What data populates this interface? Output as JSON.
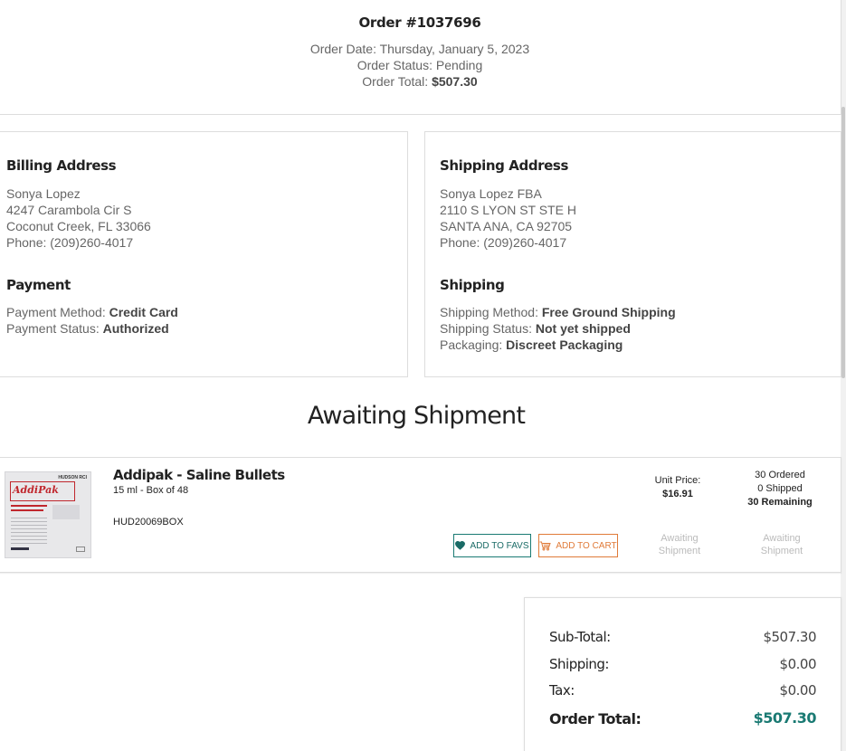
{
  "order": {
    "number": "Order #1037696",
    "date_label": "Order Date:",
    "date_value": "Thursday, January 5, 2023",
    "status_label": "Order Status:",
    "status_value": "Pending",
    "total_label": "Order Total:",
    "total_value": "$507.30"
  },
  "billing": {
    "title": "Billing Address",
    "name": "Sonya Lopez",
    "street": "4247 Carambola Cir S",
    "city": "Coconut Creek, FL 33066",
    "phone": "Phone: (209)260-4017"
  },
  "payment": {
    "title": "Payment",
    "method_label": "Payment Method:",
    "method_value": "Credit Card",
    "status_label": "Payment Status:",
    "status_value": "Authorized"
  },
  "shipping_address": {
    "title": "Shipping Address",
    "name": "Sonya Lopez FBA",
    "street": "2110 S LYON ST STE H",
    "city": "SANTA ANA, CA 92705",
    "phone": "Phone: (209)260-4017"
  },
  "shipping": {
    "title": "Shipping",
    "method_label": "Shipping Method:",
    "method_value": "Free Ground Shipping",
    "status_label": "Shipping Status:",
    "status_value": "Not yet shipped",
    "packaging_label": "Packaging:",
    "packaging_value": "Discreet Packaging"
  },
  "section_title": "Awaiting Shipment",
  "item": {
    "name": "Addipak - Saline Bullets",
    "size": "15 ml - Box of 48",
    "sku": "HUD20069BOX",
    "image_brand": "AddiPak",
    "image_maker": "HUDSON RCI",
    "fav_label": "ADD TO FAVS",
    "cart_label": "ADD TO CART",
    "unit_price_label": "Unit Price:",
    "unit_price_value": "$16.91",
    "ordered": "30 Ordered",
    "shipped": "0 Shipped",
    "remaining": "30 Remaining",
    "status_1_line1": "Awaiting",
    "status_1_line2": "Shipment",
    "status_2_line1": "Awaiting",
    "status_2_line2": "Shipment"
  },
  "totals": {
    "subtotal_label": "Sub-Total:",
    "subtotal_value": "$507.30",
    "shipping_label": "Shipping:",
    "shipping_value": "$0.00",
    "tax_label": "Tax:",
    "tax_value": "$0.00",
    "grand_label": "Order Total:",
    "grand_value": "$507.30"
  },
  "icons": {
    "favs": "heart-icon",
    "cart": "cart-icon"
  },
  "colors": {
    "accent_teal": "#1a7a73",
    "accent_orange": "#e07b39",
    "brand_red": "#c0272d"
  }
}
